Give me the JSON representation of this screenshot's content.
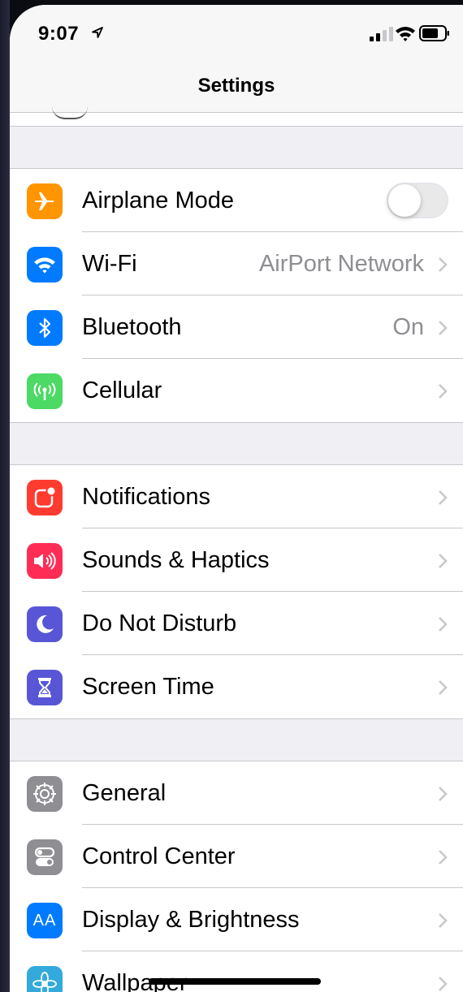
{
  "status_bar": {
    "time": "9:07"
  },
  "nav": {
    "title": "Settings"
  },
  "groups": [
    {
      "rows": [
        {
          "name": "airplane-mode",
          "label": "Airplane Mode",
          "icon": "airplane-icon",
          "icon_color": "#ff9500",
          "accessory": "toggle",
          "toggle_on": false
        },
        {
          "name": "wifi",
          "label": "Wi-Fi",
          "value": "AirPort Network",
          "icon": "wifi-icon",
          "icon_color": "#007aff",
          "accessory": "chevron"
        },
        {
          "name": "bluetooth",
          "label": "Bluetooth",
          "value": "On",
          "icon": "bluetooth-icon",
          "icon_color": "#007aff",
          "accessory": "chevron"
        },
        {
          "name": "cellular",
          "label": "Cellular",
          "icon": "antenna-icon",
          "icon_color": "#4cd964",
          "accessory": "chevron"
        }
      ]
    },
    {
      "rows": [
        {
          "name": "notifications",
          "label": "Notifications",
          "icon": "notifications-icon",
          "icon_color": "#ff3b30",
          "accessory": "chevron"
        },
        {
          "name": "sounds-haptics",
          "label": "Sounds & Haptics",
          "icon": "speaker-icon",
          "icon_color": "#ff2d55",
          "accessory": "chevron"
        },
        {
          "name": "do-not-disturb",
          "label": "Do Not Disturb",
          "icon": "moon-icon",
          "icon_color": "#5856d6",
          "accessory": "chevron"
        },
        {
          "name": "screen-time",
          "label": "Screen Time",
          "icon": "hourglass-icon",
          "icon_color": "#5856d6",
          "accessory": "chevron"
        }
      ]
    },
    {
      "rows": [
        {
          "name": "general",
          "label": "General",
          "icon": "gear-icon",
          "icon_color": "#8e8e93",
          "accessory": "chevron"
        },
        {
          "name": "control-center",
          "label": "Control Center",
          "icon": "switches-icon",
          "icon_color": "#8e8e93",
          "accessory": "chevron"
        },
        {
          "name": "display-brightness",
          "label": "Display & Brightness",
          "value_glyph": "AA",
          "icon": "text-size-icon",
          "icon_color": "#007aff",
          "accessory": "chevron"
        },
        {
          "name": "wallpaper",
          "label": "Wallpaper",
          "icon": "flower-icon",
          "icon_color": "#34aadc",
          "accessory": "chevron"
        }
      ]
    }
  ]
}
